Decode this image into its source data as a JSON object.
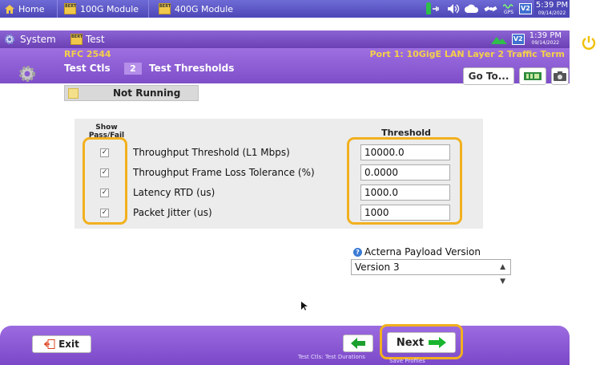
{
  "topbar": {
    "tabs": [
      {
        "label": "Home",
        "icon": "home-icon"
      },
      {
        "label": "100G Module",
        "icon": "bert-module-icon"
      },
      {
        "label": "400G Module",
        "icon": "bert-module-icon"
      }
    ],
    "status_icons": [
      "battery-plug-icon",
      "speaker-icon",
      "cloud-icon",
      "satellite-icon",
      "gps-icon",
      "v2-badge-icon"
    ],
    "gps_label": "GPS",
    "v2_label": "V2",
    "clock_time": "5:39 PM",
    "clock_date": "09/14/2022"
  },
  "appbar": {
    "system_label": "System",
    "test_label": "Test",
    "v2_label": "V2",
    "clock_time": "1:39 PM",
    "clock_date": "09/14/2022"
  },
  "header": {
    "rfc": "RFC 2544",
    "port": "Port 1: 10GigE LAN Layer 2 Traffic Term",
    "testctls": "Test Ctls",
    "step": "2",
    "thresholds": "Test Thresholds",
    "goto_label": "Go To..."
  },
  "status": {
    "text": "Not Running"
  },
  "table": {
    "show_header": "Show Pass/Fail",
    "threshold_header": "Threshold",
    "rows": [
      {
        "label": "Throughput Threshold (L1 Mbps)",
        "value": "10000.0",
        "checked": "✓"
      },
      {
        "label": "Throughput Frame Loss Tolerance (%)",
        "value": "0.0000",
        "checked": "✓"
      },
      {
        "label": "Latency RTD (us)",
        "value": "1000.0",
        "checked": "✓"
      },
      {
        "label": "Packet Jitter (us)",
        "value": "1000",
        "checked": "✓"
      }
    ]
  },
  "payload": {
    "label": "Acterna Payload Version",
    "value": "Version 3",
    "help": "?"
  },
  "bottom": {
    "exit_label": "Exit",
    "next_label": "Next",
    "hint_back": "Test Ctls: Test Durations",
    "hint_next": "Save Profiles"
  },
  "colors": {
    "accent_highlight": "#f2b01e",
    "header_purple": "#8a5bd2",
    "title_yellow": "#f5d04a"
  }
}
